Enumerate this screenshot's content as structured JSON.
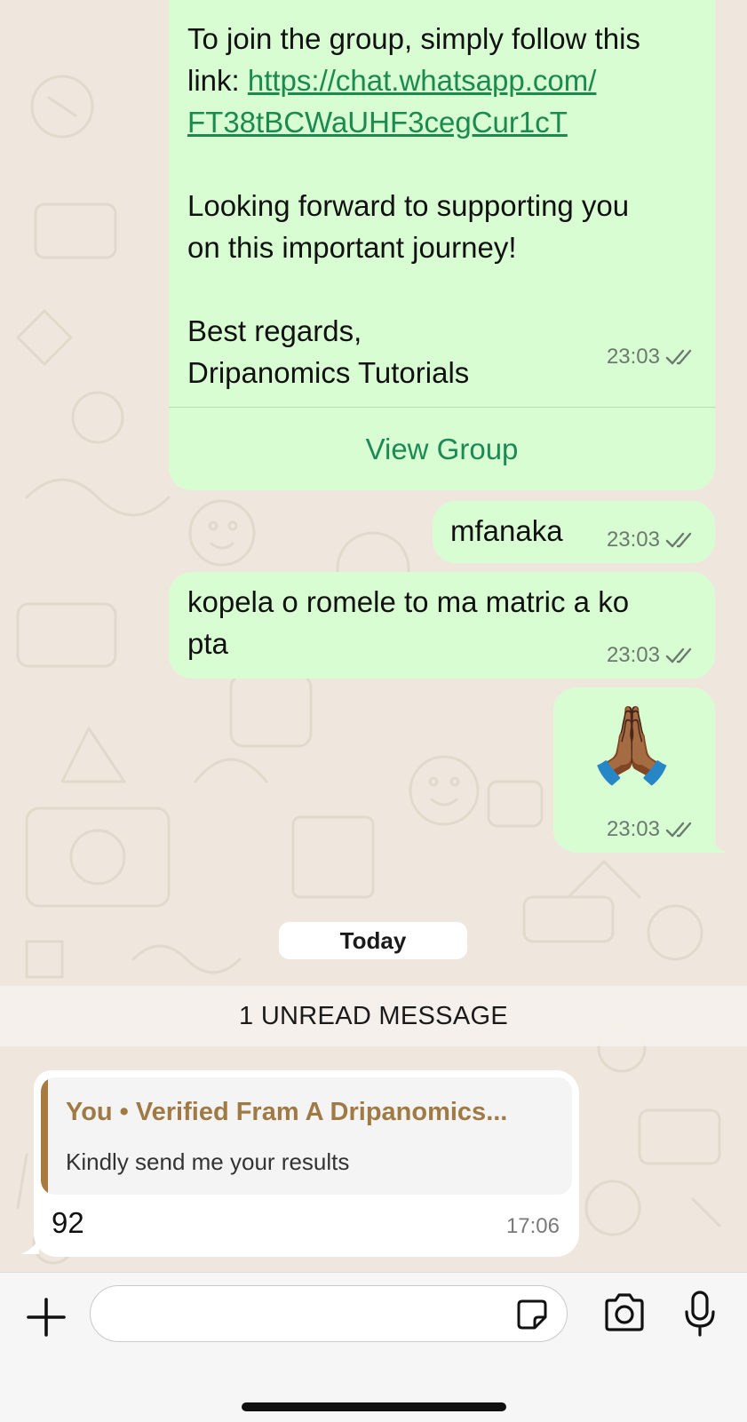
{
  "messages": {
    "group_invite": {
      "line1": "To join the group, simply follow this",
      "link_prefix": "link: ",
      "link_part1": "https://chat.whatsapp.com/",
      "link_part2": "FT38tBCWaUHF3cegCur1cT",
      "para2_line1": "Looking forward to supporting you",
      "para2_line2": "on this important journey!",
      "sign_line1": "Best regards,",
      "sign_line2": "Dripanomics Tutorials",
      "time": "23:03",
      "action_label": "View Group"
    },
    "msg2": {
      "text": "mfanaka",
      "time": "23:03"
    },
    "msg3": {
      "line1": "kopela o romele to ma matric a ko",
      "line2": "pta",
      "time": "23:03"
    },
    "msg4": {
      "emoji": "🙏🏾",
      "time": "23:03"
    },
    "date_separator": "Today",
    "unread_label": "1 UNREAD MESSAGE",
    "incoming": {
      "quote_author": "You • Verified Fram A Dripanomics...",
      "quote_text": "Kindly send me your results",
      "text": "92",
      "time": "17:06"
    }
  },
  "input_bar": {
    "message_value": "",
    "icons": [
      "plus-icon",
      "sticker-icon",
      "camera-icon",
      "microphone-icon"
    ]
  },
  "colors": {
    "outgoing_bubble": "#d9fdd3",
    "incoming_bubble": "#ffffff",
    "link": "#1b8a4e",
    "read_ticks": "#6b7a6e",
    "quote_accent": "#a77b3f"
  }
}
